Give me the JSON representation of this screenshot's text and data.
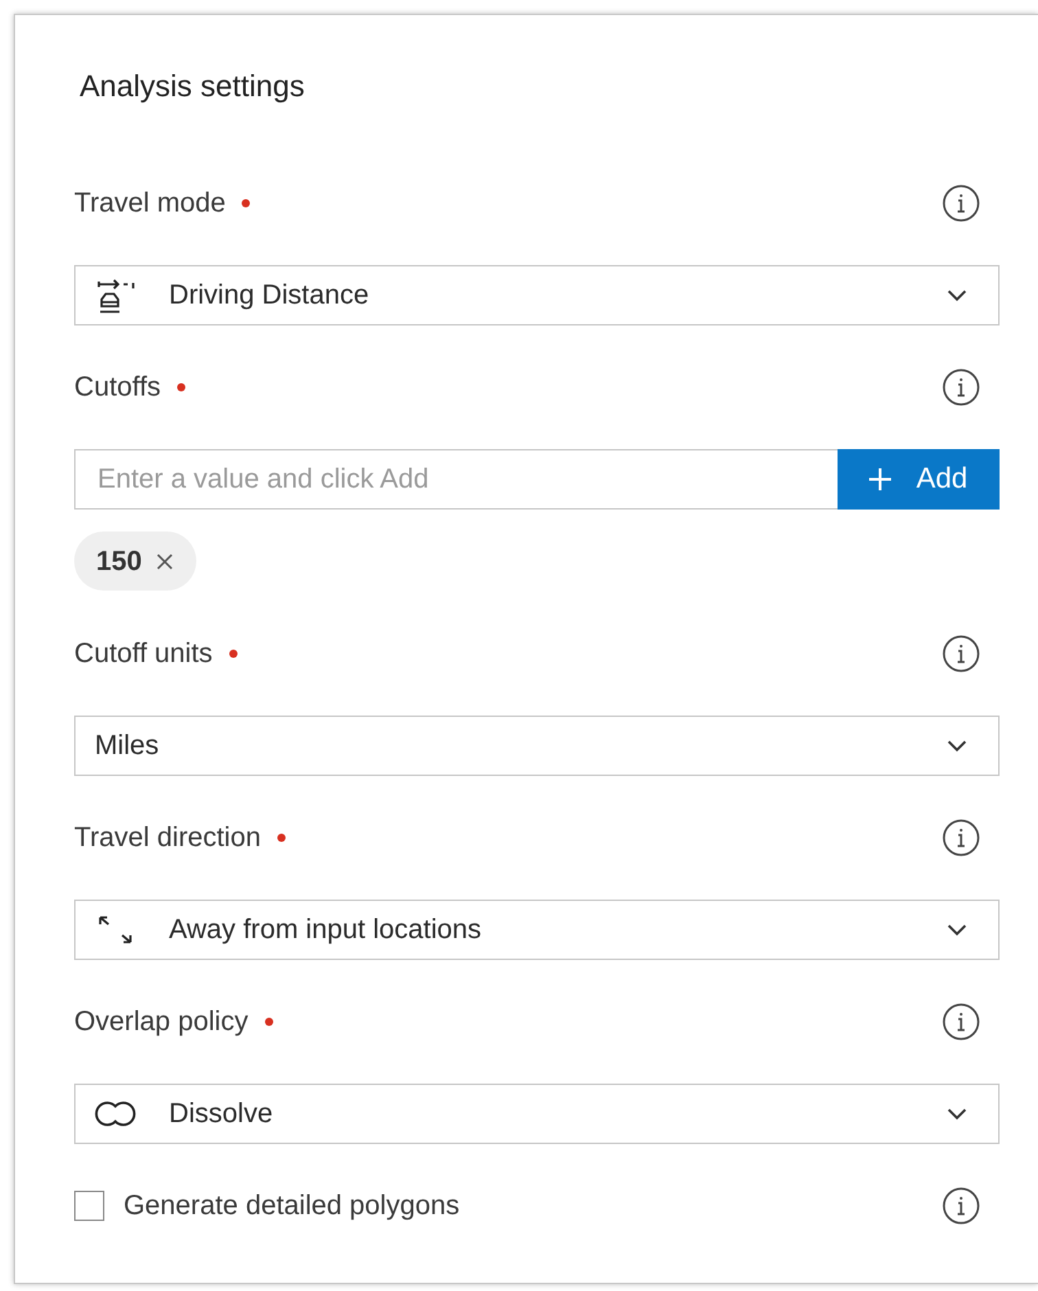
{
  "title": "Analysis settings",
  "fields": [
    {
      "kind": "select",
      "label": "Travel mode",
      "required": true,
      "value": "Driving Distance"
    },
    {
      "kind": "tags",
      "label": "Cutoffs",
      "required": true,
      "placeholder": "Enter a value and click Add",
      "button": "Add",
      "tags": [
        {
          "label": "150"
        }
      ]
    },
    {
      "kind": "select",
      "label": "Cutoff units",
      "required": true,
      "value": "Miles"
    },
    {
      "kind": "select",
      "label": "Travel direction",
      "required": true,
      "value": "Away from input locations"
    },
    {
      "kind": "select",
      "label": "Overlap policy",
      "required": true,
      "value": "Dissolve"
    }
  ],
  "checkbox": {
    "label": "Generate detailed polygons",
    "checked": false
  }
}
